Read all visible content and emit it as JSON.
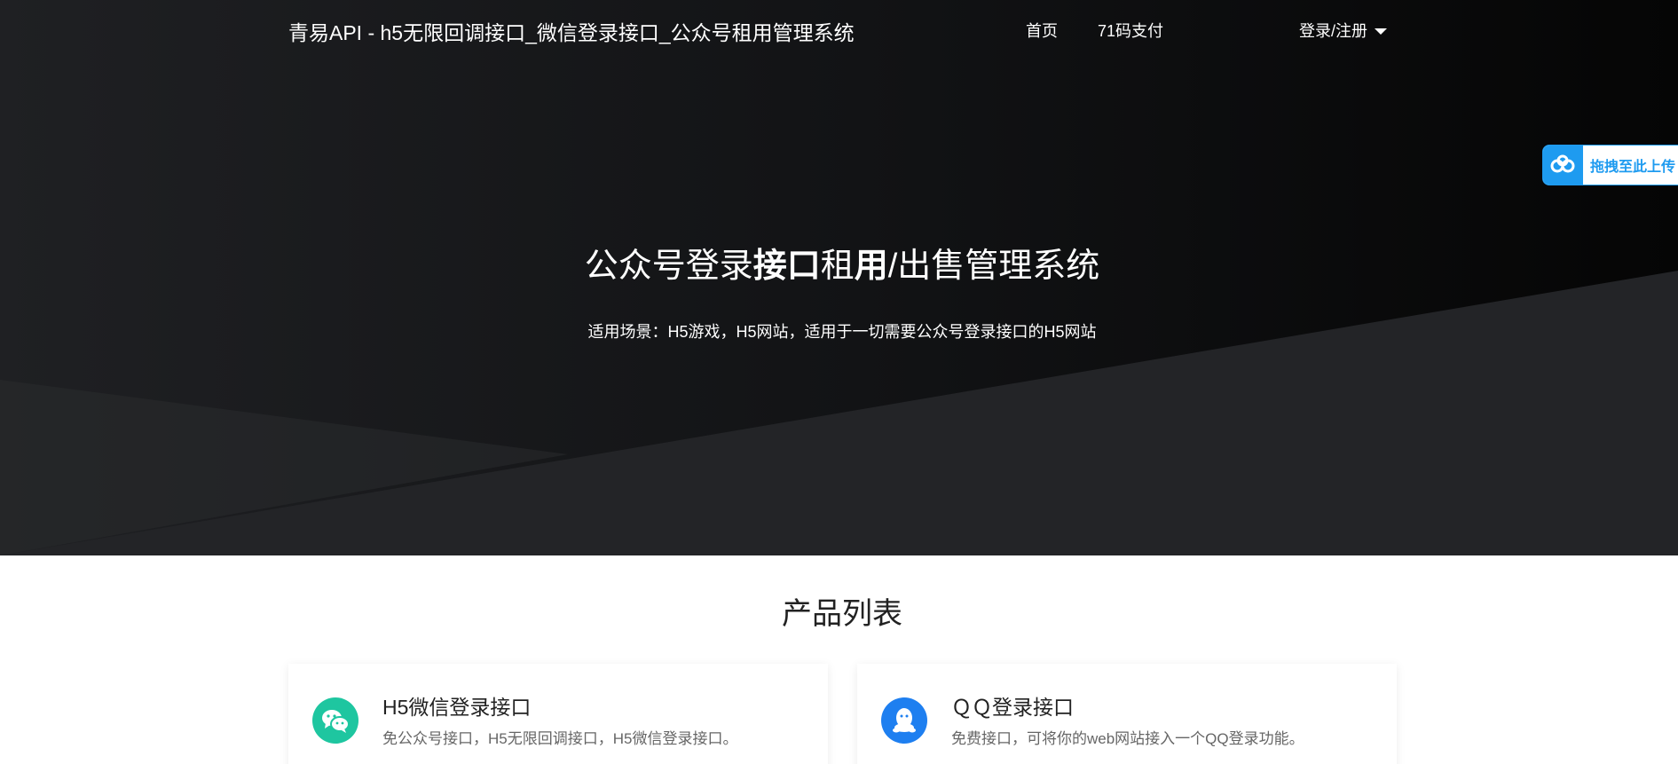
{
  "nav": {
    "brand": "青易API - h5无限回调接口_微信登录接口_公众号租用管理系统",
    "home": "首页",
    "pay": "71码支付",
    "login": "登录/注册"
  },
  "hero": {
    "title_part1": "公众号登录",
    "title_part2": "接口",
    "title_part3": "租",
    "title_part4": "用",
    "title_part5": "/出售管理系统",
    "subtitle": "适用场景：H5游戏，H5网站，适用于一切需要公众号登录接口的H5网站"
  },
  "upload_widget": {
    "label": "拖拽至此上传",
    "icon": "baidu-netdisk-icon"
  },
  "products": {
    "title": "产品列表",
    "items": [
      {
        "title": "H5微信登录接口",
        "desc": "免公众号接口，H5无限回调接口，H5微信登录接口。",
        "icon": "wechat-icon",
        "color": "#1ec6a0"
      },
      {
        "title": "ＱＱ登录接口",
        "desc": "免费接口，可将你的web网站接入一个QQ登录功能。",
        "icon": "qq-icon",
        "color": "#1e7ff0"
      }
    ]
  },
  "colors": {
    "hero_dark": "#0a0a0b",
    "accent_blue": "#1e9bf0",
    "wechat_green": "#1ec6a0",
    "qq_blue": "#1e7ff0"
  }
}
